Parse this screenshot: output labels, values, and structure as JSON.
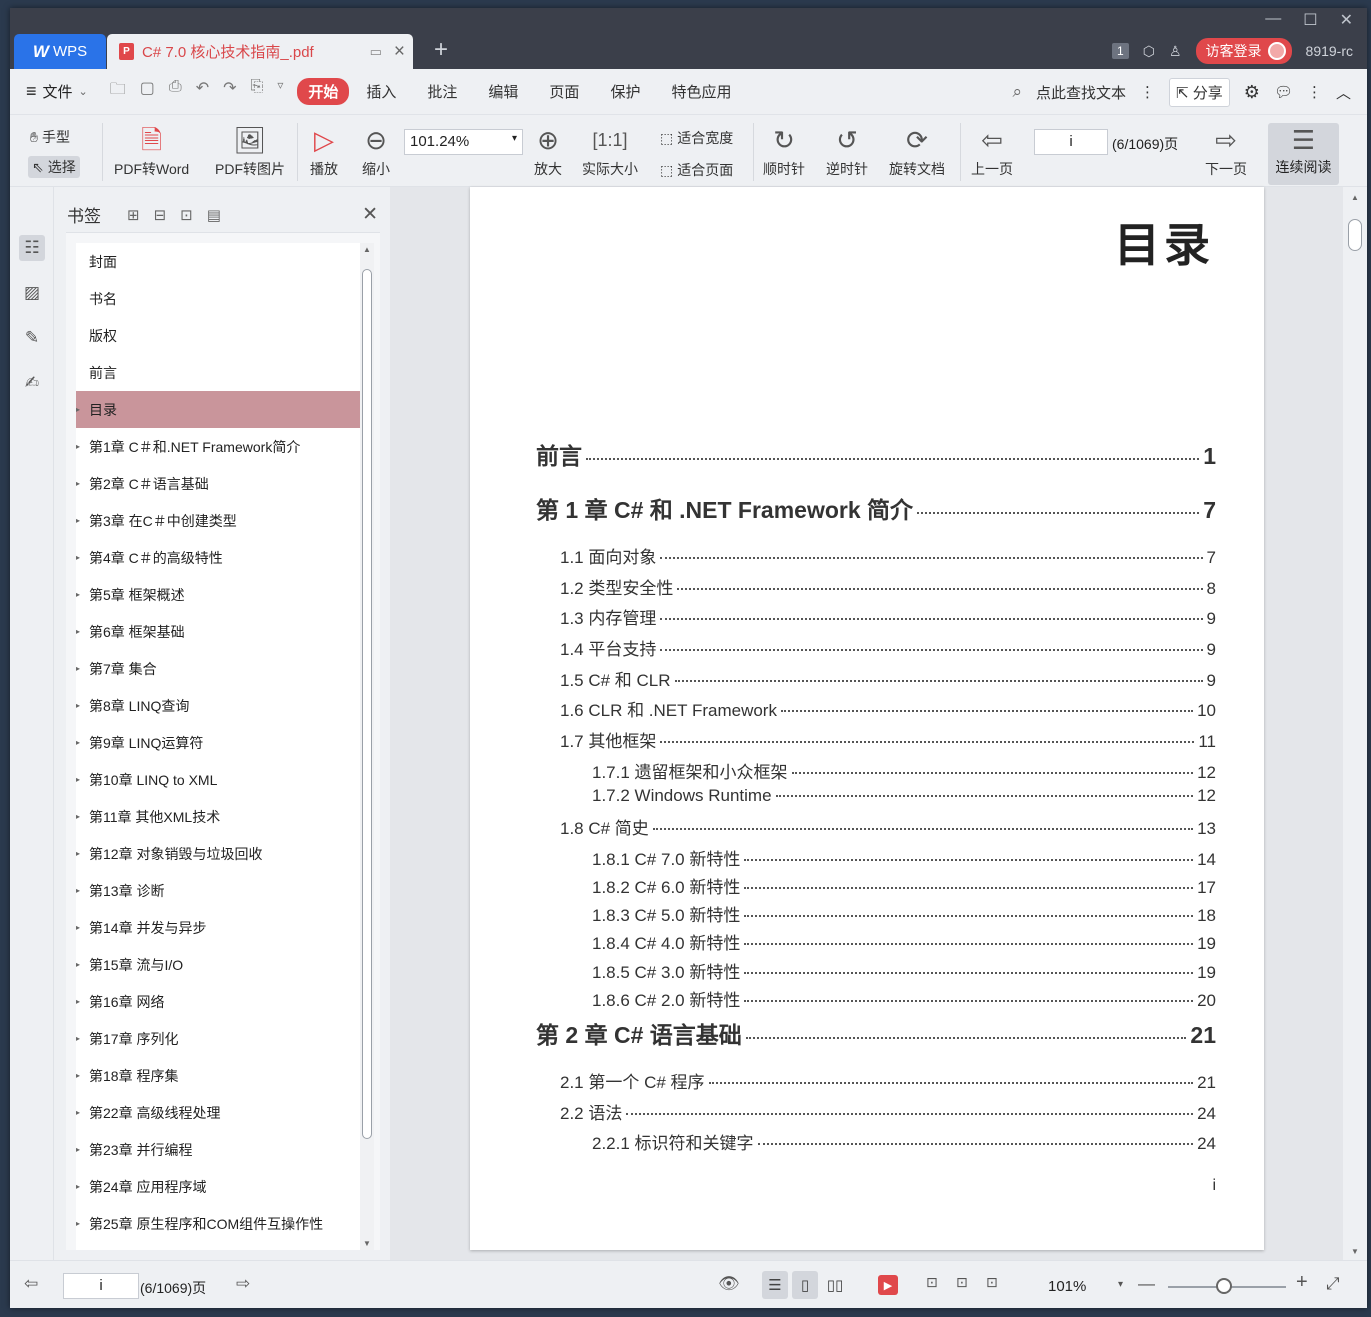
{
  "titlebar": {
    "app_name": "WPS",
    "doc_tab_title": "C# 7.0 核心技术指南_.pdf",
    "page_count_badge": "1",
    "guest_login": "访客登录",
    "user_id": "8919-rc"
  },
  "menubar": {
    "file": "文件",
    "items": [
      "开始",
      "插入",
      "批注",
      "编辑",
      "页面",
      "保护",
      "特色应用"
    ],
    "active": "开始",
    "search_text": "点此查找文本",
    "share": "分享"
  },
  "ribbon": {
    "hand": "手型",
    "select": "选择",
    "pdf_to_word": "PDF转Word",
    "pdf_to_image": "PDF转图片",
    "play": "播放",
    "zoom_out": "缩小",
    "zoom_value": "101.24%",
    "zoom_in": "放大",
    "actual_size": "实际大小",
    "fit_width": "适合宽度",
    "fit_page": "适合页面",
    "clockwise": "顺时针",
    "counterclockwise": "逆时针",
    "rotate_doc": "旋转文档",
    "prev_page": "上一页",
    "page_input": "i",
    "page_total": "(6/1069)页",
    "next_page": "下一页",
    "continuous": "连续阅读"
  },
  "bookmarks": {
    "title": "书签",
    "items": [
      {
        "label": "封面",
        "arrow": false
      },
      {
        "label": "书名",
        "arrow": false
      },
      {
        "label": "版权",
        "arrow": false
      },
      {
        "label": "前言",
        "arrow": false
      },
      {
        "label": "目录",
        "arrow": true
      },
      {
        "label": "第1章  C＃和.NET Framework简介",
        "arrow": true
      },
      {
        "label": "第2章  C＃语言基础",
        "arrow": true
      },
      {
        "label": "第3章  在C＃中创建类型",
        "arrow": true
      },
      {
        "label": "第4章  C＃的高级特性",
        "arrow": true
      },
      {
        "label": "第5章  框架概述",
        "arrow": true
      },
      {
        "label": "第6章  框架基础",
        "arrow": true
      },
      {
        "label": "第7章  集合",
        "arrow": true
      },
      {
        "label": "第8章  LINQ查询",
        "arrow": true
      },
      {
        "label": "第9章  LINQ运算符",
        "arrow": true
      },
      {
        "label": "第10章  LINQ to XML",
        "arrow": true
      },
      {
        "label": "第11章  其他XML技术",
        "arrow": true
      },
      {
        "label": "第12章  对象销毁与垃圾回收",
        "arrow": true
      },
      {
        "label": "第13章  诊断",
        "arrow": true
      },
      {
        "label": "第14章  并发与异步",
        "arrow": true
      },
      {
        "label": "第15章  流与I/O",
        "arrow": true
      },
      {
        "label": "第16章  网络",
        "arrow": true
      },
      {
        "label": "第17章  序列化",
        "arrow": true
      },
      {
        "label": "第18章  程序集",
        "arrow": true
      },
      {
        "label": "第22章  高级线程处理",
        "arrow": true
      },
      {
        "label": "第23章  并行编程",
        "arrow": true
      },
      {
        "label": "第24章  应用程序域",
        "arrow": true
      },
      {
        "label": "第25章  原生程序和COM组件互操作性",
        "arrow": true
      }
    ],
    "selected_index": 4
  },
  "page": {
    "title": "目录",
    "footer": "i",
    "toc": [
      {
        "level": 0,
        "text": "前言",
        "page": "1",
        "top": 0
      },
      {
        "level": 0,
        "text": "第 1 章   C# 和 .NET Framework 简介",
        "page": "7",
        "top": 0
      },
      {
        "level": 1,
        "text": "1.1 面向对象",
        "page": "7"
      },
      {
        "level": 1,
        "text": "1.2 类型安全性",
        "page": "8"
      },
      {
        "level": 1,
        "text": "1.3 内存管理",
        "page": "9"
      },
      {
        "level": 1,
        "text": "1.4 平台支持",
        "page": "9"
      },
      {
        "level": 1,
        "text": "1.5 C# 和 CLR",
        "page": "9"
      },
      {
        "level": 1,
        "text": "1.6 CLR 和 .NET Framework",
        "page": "10"
      },
      {
        "level": 1,
        "text": "1.7 其他框架",
        "page": "11"
      },
      {
        "level": 2,
        "text": "1.7.1 遗留框架和小众框架",
        "page": "12"
      },
      {
        "level": 2,
        "text": "1.7.2 Windows Runtime",
        "page": "12"
      },
      {
        "level": 1,
        "text": "1.8 C# 简史",
        "page": "13"
      },
      {
        "level": 2,
        "text": "1.8.1 C# 7.0 新特性",
        "page": "14"
      },
      {
        "level": 2,
        "text": "1.8.2 C# 6.0 新特性",
        "page": "17"
      },
      {
        "level": 2,
        "text": "1.8.3 C# 5.0 新特性",
        "page": "18"
      },
      {
        "level": 2,
        "text": "1.8.4 C# 4.0 新特性",
        "page": "19"
      },
      {
        "level": 2,
        "text": "1.8.5 C# 3.0 新特性",
        "page": "19"
      },
      {
        "level": 2,
        "text": "1.8.6 C# 2.0 新特性",
        "page": "20"
      },
      {
        "level": 0,
        "text": "第 2 章   C# 语言基础",
        "page": "21"
      },
      {
        "level": 1,
        "text": "2.1 第一个 C# 程序",
        "page": "21"
      },
      {
        "level": 1,
        "text": "2.2 语法",
        "page": "24"
      },
      {
        "level": 2,
        "text": "2.2.1 标识符和关键字",
        "page": "24"
      }
    ]
  },
  "statusbar": {
    "page_input": "i",
    "page_total": "(6/1069)页",
    "zoom": "101%"
  }
}
